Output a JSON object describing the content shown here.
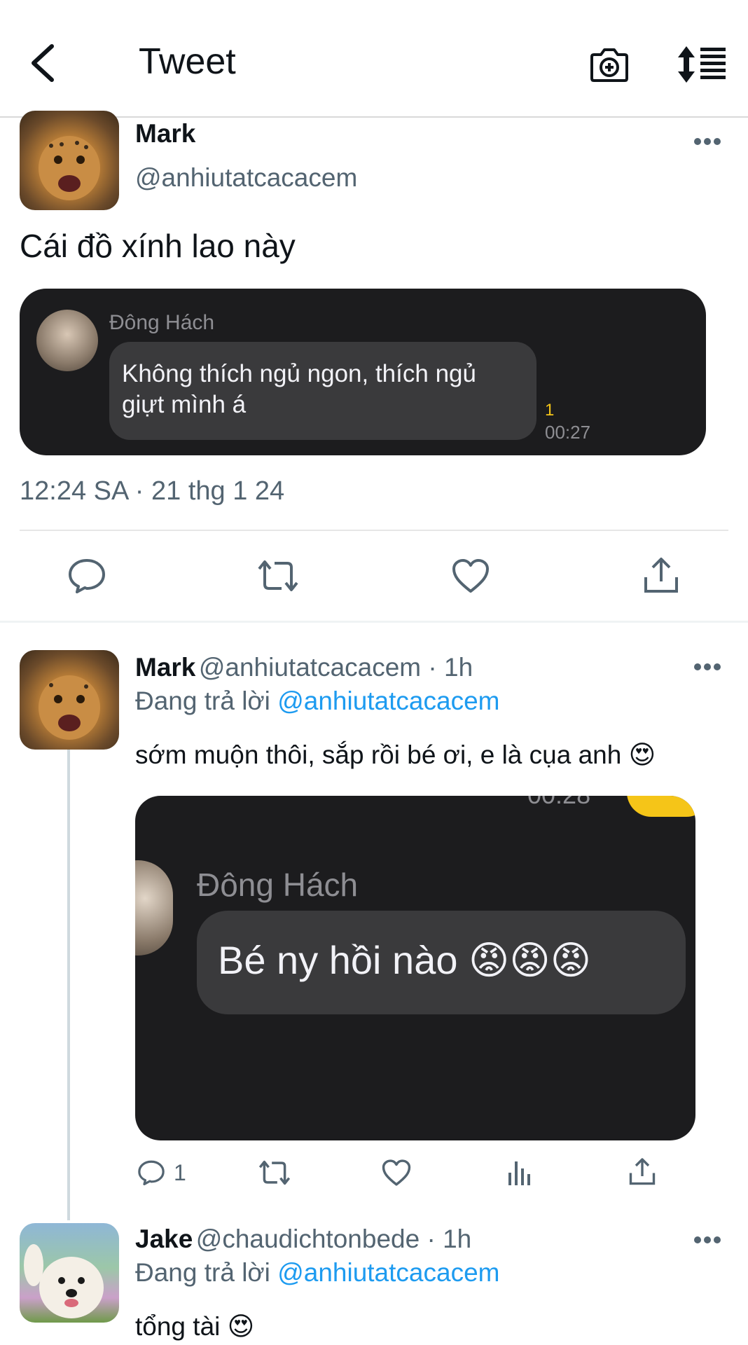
{
  "header": {
    "title": "Tweet"
  },
  "main_tweet": {
    "author_name": "Mark",
    "author_handle": "@anhiutatcacacem",
    "text": "Cái đồ xính lao này",
    "embedded_chat": {
      "sender": "Đông Hách",
      "message_line1": "Không thích ngủ ngon, thích ngủ",
      "message_line2": "giựt mình á",
      "read_count": "1",
      "time": "00:27"
    },
    "timestamp": "12:24 SA · 21 thg 1 24"
  },
  "replies": [
    {
      "author_name": "Mark",
      "author_handle": "@anhiutatcacacem",
      "time_ago": " · 1h",
      "replying_prefix": "Đang trả lời ",
      "replying_to": "@anhiutatcacacem",
      "text": "sớm muộn thôi, sắp rồi bé ơi, e là cụa anh 😍",
      "embedded_chat": {
        "top_time": "00:28",
        "sender": "Đông Hách",
        "message": "Bé ny hồi nào 😡😡😡"
      },
      "reply_count": "1"
    },
    {
      "author_name": "Jake",
      "author_handle": "@chaudichtonbede",
      "time_ago": " · 1h",
      "replying_prefix": "Đang trả lời ",
      "replying_to": "@anhiutatcacacem",
      "text": "tổng tài 😍"
    }
  ],
  "colors": {
    "accent": "#1d9bf0",
    "secondary_text": "#536471",
    "chat_bg": "#1c1c1e",
    "chat_bubble": "#3a3a3c",
    "chat_read_marker": "#f5c518"
  }
}
